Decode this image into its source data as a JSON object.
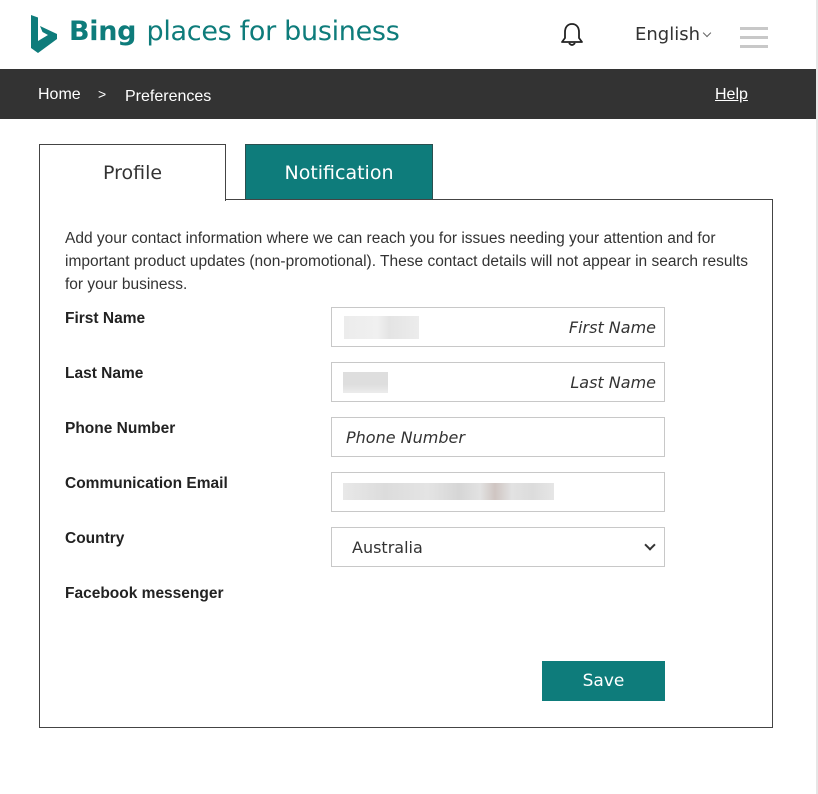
{
  "header": {
    "brand_bold": "Bing",
    "brand_rest": "places for business",
    "language": "English",
    "brand_color": "#0e7c7b"
  },
  "nav": {
    "breadcrumb": [
      {
        "label": "Home"
      },
      {
        "label": "Preferences"
      }
    ],
    "separator": ">",
    "help_label": "Help"
  },
  "tabs": [
    {
      "label": "Profile",
      "active": true
    },
    {
      "label": "Notification",
      "active": false
    }
  ],
  "form": {
    "intro": "Add your contact information where we can reach you for issues needing your attention and for important product updates (non-promotional). These contact details will not appear in search results for your business.",
    "fields": [
      {
        "label": "First Name",
        "placeholder": "First Name",
        "value": "[redacted]"
      },
      {
        "label": "Last Name",
        "placeholder": "Last Name",
        "value": "[redacted]"
      },
      {
        "label": "Phone Number",
        "placeholder": "Phone Number",
        "value": ""
      },
      {
        "label": "Communication Email",
        "placeholder": "",
        "value": "[redacted]"
      },
      {
        "label": "Country",
        "selected": "Australia"
      },
      {
        "label": "Facebook messenger"
      }
    ],
    "save_label": "Save"
  }
}
